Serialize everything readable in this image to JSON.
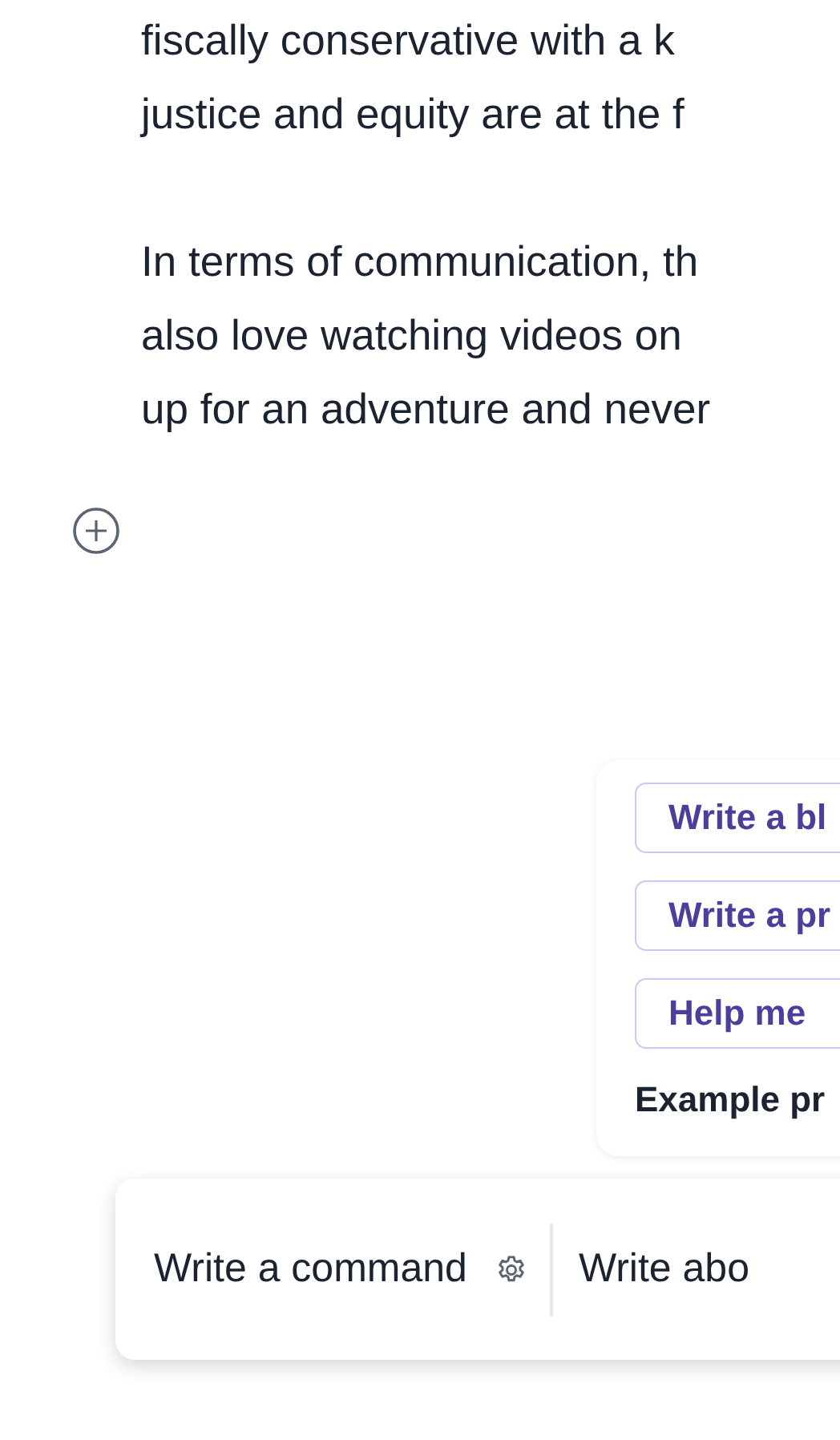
{
  "document": {
    "paragraphs": [
      {
        "lines": [
          "fiscally conservative with a k",
          "justice and equity are at the f"
        ]
      },
      {
        "lines": [
          "In terms of communication, th",
          "also love watching videos on",
          "up for an adventure and never"
        ]
      }
    ]
  },
  "example_prompts": {
    "prompts": [
      "Write a bl",
      "Write a pr",
      "Help me"
    ],
    "label": "Example pr"
  },
  "command_bar": {
    "placeholder": "Write a command",
    "value": "Write abo"
  }
}
